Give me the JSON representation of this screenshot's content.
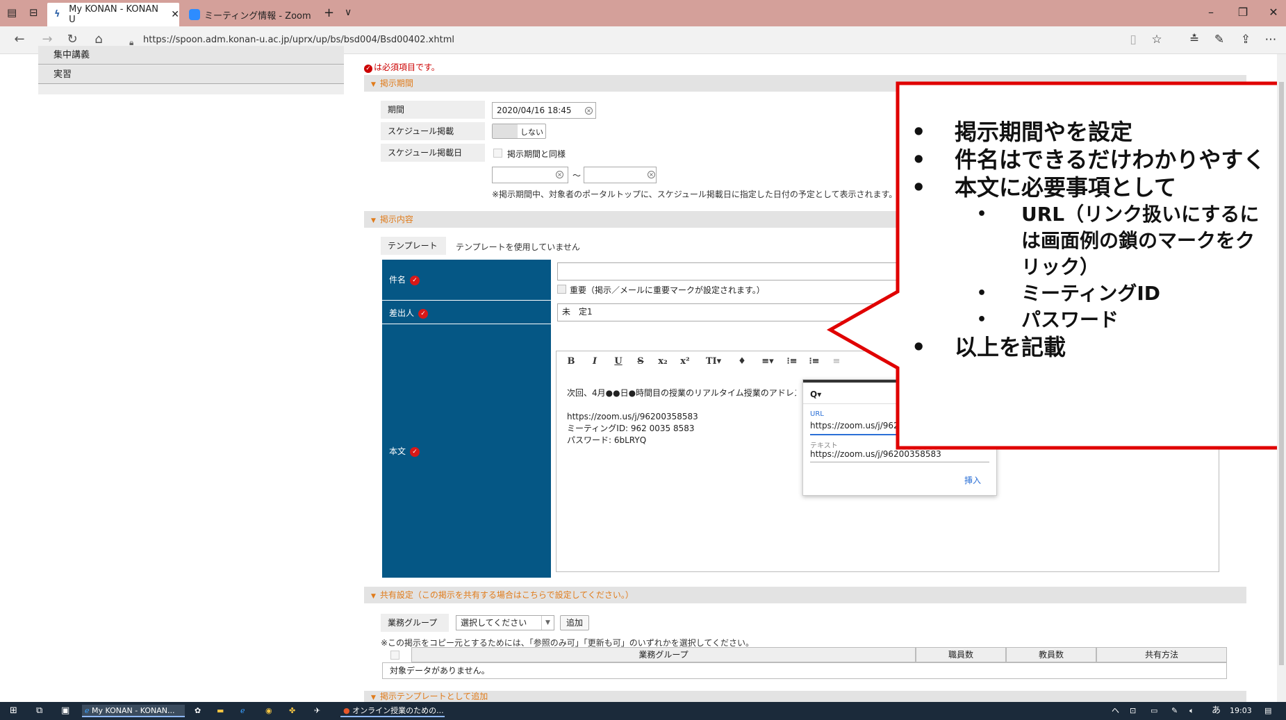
{
  "browser": {
    "tabs": [
      {
        "label": "My KONAN - KONAN U",
        "active": true
      },
      {
        "label": "ミーティング情報 - Zoom",
        "active": false
      }
    ],
    "new_tab": "+",
    "tab_dropdown": "∨",
    "url": "https://spoon.adm.konan-u.ac.jp/uprx/up/bs/bsd004/Bsd00402.xhtml"
  },
  "leftnav": {
    "items": [
      "集中講義",
      "実習"
    ]
  },
  "form": {
    "required_note": "は必須項目です。",
    "section_period": "掲示期間",
    "period_label": "期間",
    "period_value": "2020/04/16 18:45",
    "schedule_label": "スケジュール掲載",
    "schedule_toggle": "しない",
    "schedule_date_label": "スケジュール掲載日",
    "schedule_same": "掲示期間と同様",
    "tilde": "～",
    "schedule_note": "※掲示期間中、対象者のポータルトップに、スケジュール掲載日に指定した日付の予定として表示されます。",
    "section_content": "掲示内容",
    "template_label": "テンプレート",
    "template_value": "テンプレートを使用していません",
    "subject_label": "件名",
    "important_label": "重要（掲示／メールに重要マークが設定されます。）",
    "sender_label": "差出人",
    "sender_value": "未　定1",
    "body_label": "本文",
    "body_lines": [
      "次回、4月●●日●時間目の授業のリアルタイム授業のアドレス",
      "https://zoom.us/j/96200358583",
      "ミーティングID: 962 0035 8583",
      "パスワード: 6bLRYQ"
    ],
    "toolbar": [
      "B",
      "I",
      "U",
      "S",
      "x₂",
      "x²",
      "TI▾",
      "♦",
      "≡▾",
      "⁝≡",
      "⁝≡",
      "≡"
    ]
  },
  "link_popup": {
    "search": "Q▾",
    "url_label": "URL",
    "url_value": "https://zoom.us/j/962",
    "text_label": "テキスト",
    "text_value": "https://zoom.us/j/96200358583",
    "insert": "挿入"
  },
  "callout": {
    "items": [
      {
        "level": 1,
        "text": "掲示期間やを設定"
      },
      {
        "level": 1,
        "text": "件名はできるだけわかりやすく"
      },
      {
        "level": 1,
        "text": "本文に必要事項として"
      },
      {
        "level": 2,
        "text": "URL（リンク扱いにするには画面例の鎖のマークをクリック）"
      },
      {
        "level": 2,
        "text": "ミーティングID"
      },
      {
        "level": 2,
        "text": "パスワード"
      },
      {
        "level": 1,
        "text": "以上を記載"
      }
    ],
    "border_color": "#e00000"
  },
  "share": {
    "section": "共有設定（この掲示を共有する場合はこちらで設定してください。）",
    "group_label": "業務グループ",
    "select_value": "選択してください",
    "add_button": "追加",
    "note": "※この掲示をコピー元とするためには、「参照のみ可」「更新も可」のいずれかを選択してください。",
    "columns": [
      "業務グループ",
      "職員数",
      "教員数",
      "共有方法"
    ],
    "empty": "対象データがありません。"
  },
  "template_add_section": "掲示テンプレートとして追加",
  "taskbar": {
    "items": [
      "My KONAN - KONAN...",
      "オンライン授業のための..."
    ],
    "tray": "ヘ",
    "ime": "あ",
    "time": "19:03"
  },
  "colors": {
    "title_bar": "#d4a09a",
    "label_column": "#055785",
    "section_text": "#e07b1a",
    "required": "#d81818"
  }
}
